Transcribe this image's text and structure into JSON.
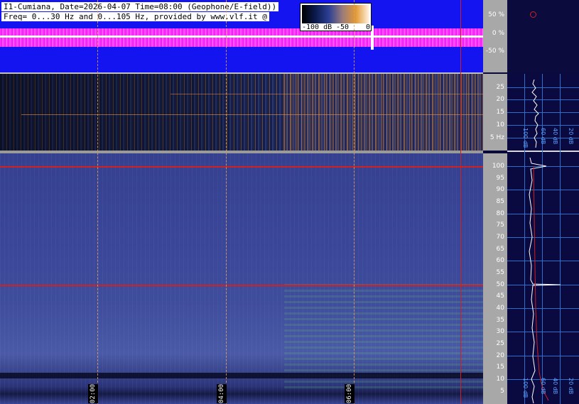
{
  "header": {
    "line1": "I1-Cumiana, Date=2026-04-07 Time=08:00 (Geophone/E-field))",
    "line2": "Freq= 0...30 Hz and 0...105 Hz, provided by www.vlf.it @"
  },
  "colorbar": {
    "labels": [
      "-100 dB",
      "-50",
      "0"
    ]
  },
  "amplitude_scale": {
    "ticks": [
      "50 %",
      "0 %",
      "-50 %"
    ]
  },
  "upper_freq_scale": {
    "ticks": [
      "25",
      "20",
      "15",
      "10",
      "5 Hz"
    ]
  },
  "lower_freq_scale": {
    "ticks": [
      "100",
      "95",
      "90",
      "85",
      "80",
      "75",
      "70",
      "65",
      "60",
      "55",
      "50",
      "45",
      "40",
      "35",
      "30",
      "25",
      "20",
      "15",
      "10",
      "5"
    ]
  },
  "time_markers": [
    "02:00",
    "04:00",
    "06:00"
  ],
  "profile": {
    "upper_labels": [
      "100 dB",
      "60 dB",
      "40 dB",
      "20 dB"
    ],
    "lower_labels": [
      "100 dB",
      "60 dB",
      "40 dB",
      "20 dB"
    ]
  },
  "colors": {
    "waveform_bg": "#1414f0",
    "waveform": "#ff2bff",
    "mains_line": "#d02020",
    "scale_bg": "#a8a8a8",
    "profile_grid": "#2b6fc9"
  }
}
